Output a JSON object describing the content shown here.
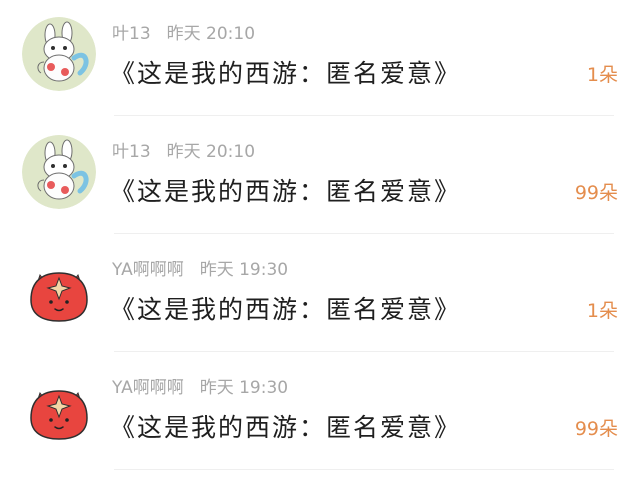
{
  "list": {
    "items": [
      {
        "avatar_icon": "bunny-avatar-icon",
        "username": "叶13",
        "time": "昨天 20:10",
        "message": "《这是我的西游：匿名爱意》",
        "count": "1朵"
      },
      {
        "avatar_icon": "bunny-avatar-icon",
        "username": "叶13",
        "time": "昨天 20:10",
        "message": "《这是我的西游：匿名爱意》",
        "count": "99朵"
      },
      {
        "avatar_icon": "red-monster-avatar-icon",
        "username": "YA啊啊啊",
        "time": "昨天 19:30",
        "message": "《这是我的西游：匿名爱意》",
        "count": "1朵"
      },
      {
        "avatar_icon": "red-monster-avatar-icon",
        "username": "YA啊啊啊",
        "time": "昨天 19:30",
        "message": "《这是我的西游：匿名爱意》",
        "count": "99朵"
      }
    ]
  },
  "colors": {
    "meta_text": "#a7a7a7",
    "message_text": "#1f1f1f",
    "count_text": "#e48d4d",
    "divider": "#efefef"
  }
}
